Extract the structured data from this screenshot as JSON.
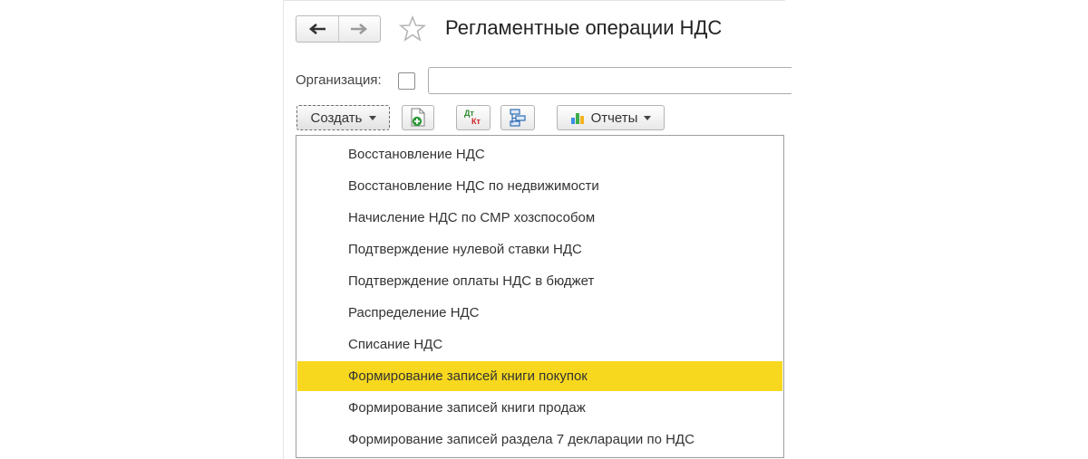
{
  "window": {
    "title": "Регламентные операции НДС",
    "back_icon": "arrow-left-icon",
    "forward_icon": "arrow-right-icon",
    "favorite_icon": "star-icon"
  },
  "filter": {
    "organization_label": "Организация:",
    "organization_checked": false,
    "organization_value": ""
  },
  "toolbar": {
    "create_label": "Создать",
    "reports_label": "Отчеты",
    "dt_label": "Дт",
    "kt_label": "Кт"
  },
  "menu": {
    "items": [
      "Восстановление НДС",
      "Восстановление НДС по недвижимости",
      "Начисление НДС по СМР хозспособом",
      "Подтверждение нулевой ставки НДС",
      "Подтверждение оплаты НДС в бюджет",
      "Распределение НДС",
      "Списание НДС",
      "Формирование записей книги покупок",
      "Формирование записей книги продаж",
      "Формирование записей раздела 7 декларации по НДС"
    ],
    "highlighted_index": 7
  },
  "colors": {
    "highlight": "#f7d81e",
    "text": "#333333",
    "border": "#9e9e9e"
  }
}
